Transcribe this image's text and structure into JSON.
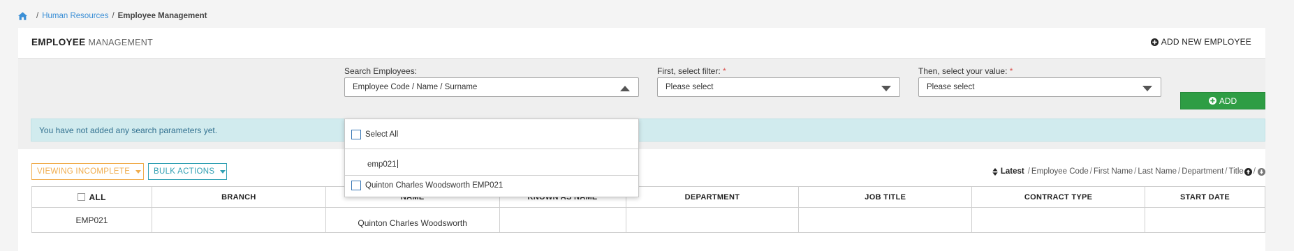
{
  "breadcrumb": {
    "items": [
      "Human Resources"
    ],
    "separator": "/",
    "current": "Employee Management"
  },
  "header": {
    "title_bold": "EMPLOYEE",
    "title_light": "MANAGEMENT",
    "add_new_label": "ADD NEW EMPLOYEE"
  },
  "filters": {
    "search_label": "Search Employees:",
    "search_value": "Employee Code / Name / Surname",
    "filter_label": "First, select filter:",
    "filter_value": "Please select",
    "value_label": "Then, select your value:",
    "value_value": "Please select",
    "required_mark": "*",
    "add_label": "ADD",
    "info_text": "You have not added any search parameters yet."
  },
  "dropdown": {
    "select_all_label": "Select All",
    "search_text": "emp021",
    "options": [
      "Quinton Charles Woodsworth EMP021"
    ]
  },
  "toolbar": {
    "viewing_label": "VIEWING INCOMPLETE",
    "bulk_label": "BULK ACTIONS"
  },
  "sort": {
    "active": "Latest",
    "options": [
      "Employee Code",
      "First Name",
      "Last Name",
      "Department",
      "Title"
    ],
    "separator": "/"
  },
  "table": {
    "columns": [
      "ALL",
      "BRANCH",
      "NAME",
      "KNOWN AS NAME",
      "DEPARTMENT",
      "JOB TITLE",
      "CONTRACT TYPE",
      "START DATE"
    ],
    "rows": [
      {
        "code": "EMP021",
        "branch": "",
        "name": "Quinton Charles Woodsworth",
        "known_as": "",
        "department": "",
        "job_title": "",
        "contract_type": "",
        "start_date": ""
      }
    ]
  },
  "colors": {
    "link": "#3b8fd6",
    "primary_green": "#2e9d44",
    "warning": "#f0ad4e",
    "info": "#31a0b3",
    "info_bg": "#d1ebee"
  },
  "icons": [
    "home-icon",
    "plus-circle-icon",
    "sort-icon",
    "arrow-up-circle-icon",
    "arrow-down-circle-icon",
    "caret-down-icon",
    "caret-up-icon",
    "checkbox-icon"
  ]
}
